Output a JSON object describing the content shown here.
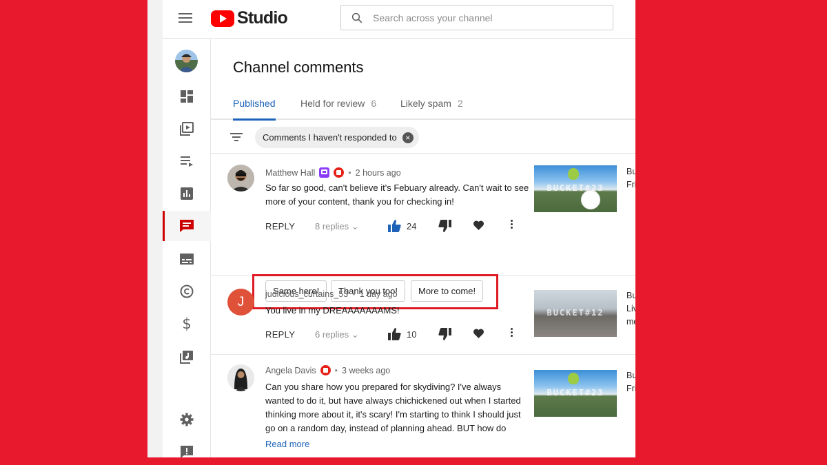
{
  "app": {
    "logo_text": "Studio"
  },
  "search": {
    "placeholder": "Search across your channel"
  },
  "sidebar": {
    "items": [
      {
        "name": "dashboard",
        "icon": "dashboard-icon"
      },
      {
        "name": "content",
        "icon": "video-library-icon"
      },
      {
        "name": "playlists",
        "icon": "playlist-icon"
      },
      {
        "name": "analytics",
        "icon": "bar-chart-icon"
      },
      {
        "name": "comments",
        "icon": "comment-icon",
        "active": true
      },
      {
        "name": "subtitles",
        "icon": "subtitles-icon"
      },
      {
        "name": "copyright",
        "icon": "copyright-icon"
      },
      {
        "name": "monetization",
        "icon": "dollar-icon"
      },
      {
        "name": "audio-library",
        "icon": "audio-library-icon"
      },
      {
        "name": "settings",
        "icon": "gear-icon"
      },
      {
        "name": "feedback",
        "icon": "feedback-icon"
      }
    ]
  },
  "page": {
    "title": "Channel comments"
  },
  "tabs": [
    {
      "label": "Published",
      "count": ""
    },
    {
      "label": "Held for review",
      "count": "6"
    },
    {
      "label": "Likely spam",
      "count": "2"
    }
  ],
  "filter": {
    "chip_label": "Comments I haven't responded to"
  },
  "comments": [
    {
      "author": "Matthew Hall",
      "time": "2 hours ago",
      "text": "So far so good, can't believe it's Febuary already. Can't wait to see more of your content, thank you for checking in!",
      "reply_label": "REPLY",
      "replies_label": "8 replies",
      "likes": "24",
      "thumb_label": "BUCKET#23",
      "video_title_partial": [
        "Bu",
        "Fri"
      ]
    },
    {
      "author": "judicious_curtains_53",
      "avatar_letter": "J",
      "time": "1 day ago",
      "text": "You live in my DREAAAAAAAMS!",
      "reply_label": "REPLY",
      "replies_label": "6 replies",
      "likes": "10",
      "thumb_label": "BUCKET#12",
      "video_title_partial": [
        "Bu",
        "Liv",
        "me"
      ]
    },
    {
      "author": "Angela Davis",
      "time": "3 weeks ago",
      "text": "Can you share how you prepared for skydiving? I've always wanted to do it, but have always chichickened out when I started thinking more about it, it's scary! I'm starting to think I should just go on a random day, instead of planning ahead. BUT how do",
      "read_more": "Read more",
      "thumb_label": "BUCKET#23",
      "video_title_partial": [
        "Bu",
        "Fri"
      ]
    }
  ],
  "smart_replies": [
    "Same here!",
    "Thank you too!",
    "More to come!"
  ],
  "colors": {
    "background": "#e8192c",
    "accent_blue": "#1c62b9",
    "highlight_box": "#e01a24",
    "like_active": "#1c62b9"
  }
}
